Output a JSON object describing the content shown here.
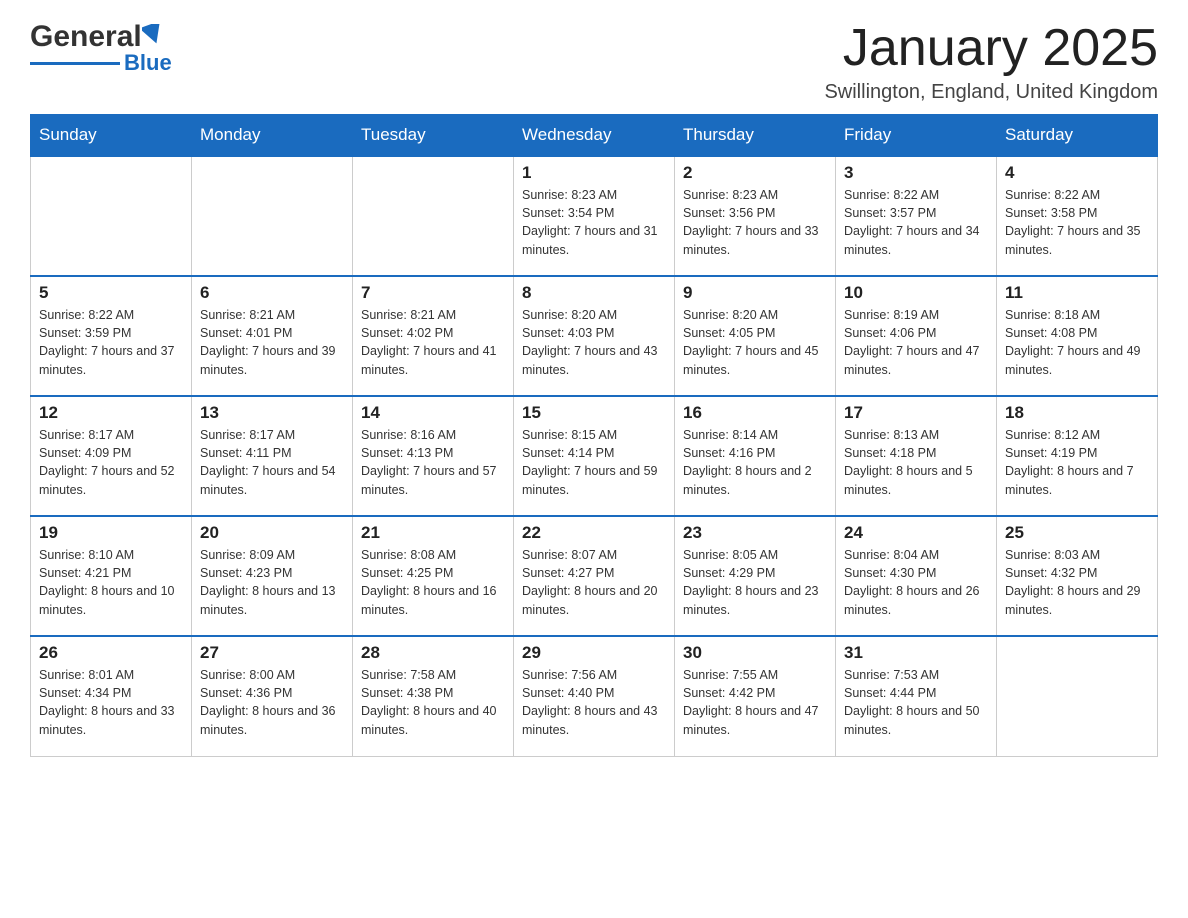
{
  "header": {
    "logo": {
      "part1": "General",
      "part2": "Blue"
    },
    "title": "January 2025",
    "location": "Swillington, England, United Kingdom"
  },
  "weekdays": [
    "Sunday",
    "Monday",
    "Tuesday",
    "Wednesday",
    "Thursday",
    "Friday",
    "Saturday"
  ],
  "weeks": [
    [
      {
        "day": "",
        "info": ""
      },
      {
        "day": "",
        "info": ""
      },
      {
        "day": "",
        "info": ""
      },
      {
        "day": "1",
        "info": "Sunrise: 8:23 AM\nSunset: 3:54 PM\nDaylight: 7 hours and 31 minutes."
      },
      {
        "day": "2",
        "info": "Sunrise: 8:23 AM\nSunset: 3:56 PM\nDaylight: 7 hours and 33 minutes."
      },
      {
        "day": "3",
        "info": "Sunrise: 8:22 AM\nSunset: 3:57 PM\nDaylight: 7 hours and 34 minutes."
      },
      {
        "day": "4",
        "info": "Sunrise: 8:22 AM\nSunset: 3:58 PM\nDaylight: 7 hours and 35 minutes."
      }
    ],
    [
      {
        "day": "5",
        "info": "Sunrise: 8:22 AM\nSunset: 3:59 PM\nDaylight: 7 hours and 37 minutes."
      },
      {
        "day": "6",
        "info": "Sunrise: 8:21 AM\nSunset: 4:01 PM\nDaylight: 7 hours and 39 minutes."
      },
      {
        "day": "7",
        "info": "Sunrise: 8:21 AM\nSunset: 4:02 PM\nDaylight: 7 hours and 41 minutes."
      },
      {
        "day": "8",
        "info": "Sunrise: 8:20 AM\nSunset: 4:03 PM\nDaylight: 7 hours and 43 minutes."
      },
      {
        "day": "9",
        "info": "Sunrise: 8:20 AM\nSunset: 4:05 PM\nDaylight: 7 hours and 45 minutes."
      },
      {
        "day": "10",
        "info": "Sunrise: 8:19 AM\nSunset: 4:06 PM\nDaylight: 7 hours and 47 minutes."
      },
      {
        "day": "11",
        "info": "Sunrise: 8:18 AM\nSunset: 4:08 PM\nDaylight: 7 hours and 49 minutes."
      }
    ],
    [
      {
        "day": "12",
        "info": "Sunrise: 8:17 AM\nSunset: 4:09 PM\nDaylight: 7 hours and 52 minutes."
      },
      {
        "day": "13",
        "info": "Sunrise: 8:17 AM\nSunset: 4:11 PM\nDaylight: 7 hours and 54 minutes."
      },
      {
        "day": "14",
        "info": "Sunrise: 8:16 AM\nSunset: 4:13 PM\nDaylight: 7 hours and 57 minutes."
      },
      {
        "day": "15",
        "info": "Sunrise: 8:15 AM\nSunset: 4:14 PM\nDaylight: 7 hours and 59 minutes."
      },
      {
        "day": "16",
        "info": "Sunrise: 8:14 AM\nSunset: 4:16 PM\nDaylight: 8 hours and 2 minutes."
      },
      {
        "day": "17",
        "info": "Sunrise: 8:13 AM\nSunset: 4:18 PM\nDaylight: 8 hours and 5 minutes."
      },
      {
        "day": "18",
        "info": "Sunrise: 8:12 AM\nSunset: 4:19 PM\nDaylight: 8 hours and 7 minutes."
      }
    ],
    [
      {
        "day": "19",
        "info": "Sunrise: 8:10 AM\nSunset: 4:21 PM\nDaylight: 8 hours and 10 minutes."
      },
      {
        "day": "20",
        "info": "Sunrise: 8:09 AM\nSunset: 4:23 PM\nDaylight: 8 hours and 13 minutes."
      },
      {
        "day": "21",
        "info": "Sunrise: 8:08 AM\nSunset: 4:25 PM\nDaylight: 8 hours and 16 minutes."
      },
      {
        "day": "22",
        "info": "Sunrise: 8:07 AM\nSunset: 4:27 PM\nDaylight: 8 hours and 20 minutes."
      },
      {
        "day": "23",
        "info": "Sunrise: 8:05 AM\nSunset: 4:29 PM\nDaylight: 8 hours and 23 minutes."
      },
      {
        "day": "24",
        "info": "Sunrise: 8:04 AM\nSunset: 4:30 PM\nDaylight: 8 hours and 26 minutes."
      },
      {
        "day": "25",
        "info": "Sunrise: 8:03 AM\nSunset: 4:32 PM\nDaylight: 8 hours and 29 minutes."
      }
    ],
    [
      {
        "day": "26",
        "info": "Sunrise: 8:01 AM\nSunset: 4:34 PM\nDaylight: 8 hours and 33 minutes."
      },
      {
        "day": "27",
        "info": "Sunrise: 8:00 AM\nSunset: 4:36 PM\nDaylight: 8 hours and 36 minutes."
      },
      {
        "day": "28",
        "info": "Sunrise: 7:58 AM\nSunset: 4:38 PM\nDaylight: 8 hours and 40 minutes."
      },
      {
        "day": "29",
        "info": "Sunrise: 7:56 AM\nSunset: 4:40 PM\nDaylight: 8 hours and 43 minutes."
      },
      {
        "day": "30",
        "info": "Sunrise: 7:55 AM\nSunset: 4:42 PM\nDaylight: 8 hours and 47 minutes."
      },
      {
        "day": "31",
        "info": "Sunrise: 7:53 AM\nSunset: 4:44 PM\nDaylight: 8 hours and 50 minutes."
      },
      {
        "day": "",
        "info": ""
      }
    ]
  ]
}
